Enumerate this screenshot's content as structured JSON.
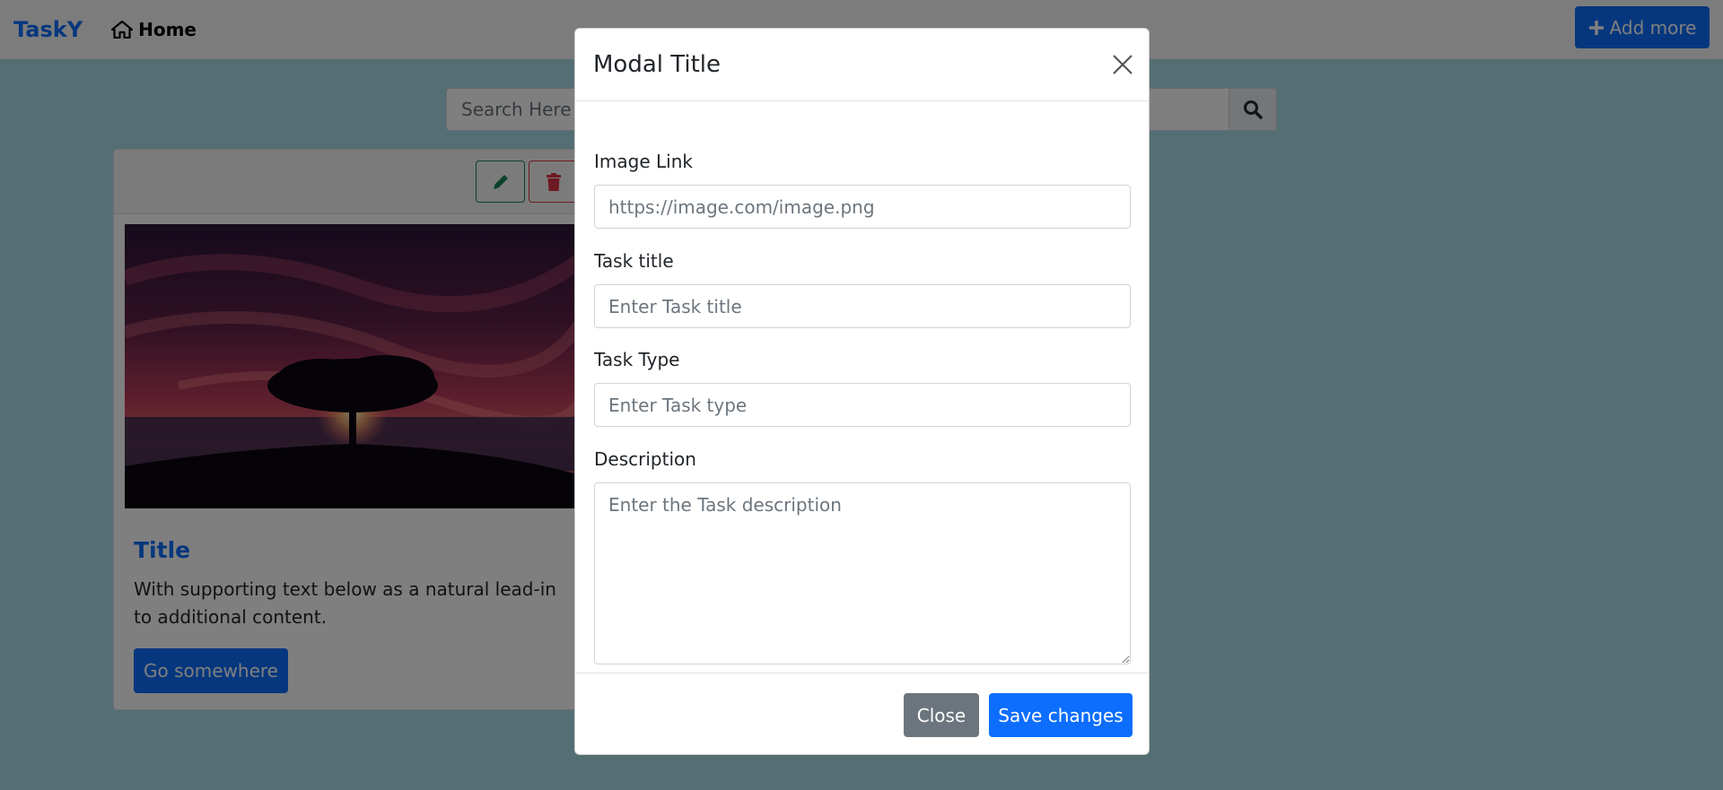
{
  "navbar": {
    "brand": "TaskY",
    "home_label": "Home",
    "add_more_label": "Add more"
  },
  "search": {
    "placeholder": "Search Here"
  },
  "card": {
    "title": "Title",
    "text": "With supporting text below as a natural lead-in to additional content.",
    "button_label": "Go somewhere"
  },
  "modal": {
    "title": "Modal Title",
    "fields": {
      "image_link": {
        "label": "Image Link",
        "placeholder": "https://image.com/image.png"
      },
      "task_title": {
        "label": "Task title",
        "placeholder": "Enter Task title"
      },
      "task_type": {
        "label": "Task Type",
        "placeholder": "Enter Task type"
      },
      "description": {
        "label": "Description",
        "placeholder": "Enter the Task description"
      }
    },
    "close_label": "Close",
    "save_label": "Save changes"
  },
  "icons": {
    "home": "home-icon",
    "plus": "plus-icon",
    "search": "search-icon",
    "edit": "pencil-icon",
    "delete": "trash-icon",
    "close": "close-icon"
  },
  "colors": {
    "primary": "#0d6efd",
    "secondary": "#6c757d",
    "success": "#198754",
    "danger": "#dc3545",
    "page_background": "#a9dce8"
  }
}
